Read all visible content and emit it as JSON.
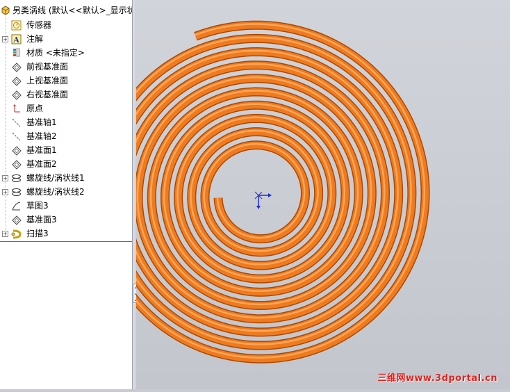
{
  "tree": {
    "root_label": "另类涡线 (默认<<默认>_显示状",
    "items": [
      {
        "label": "传感器",
        "icon": "sensor-icon",
        "expander": false
      },
      {
        "label": "注解",
        "icon": "annotation-icon",
        "expander": true
      },
      {
        "label": "材质 <未指定>",
        "icon": "material-icon",
        "expander": false
      },
      {
        "label": "前视基准面",
        "icon": "plane-icon",
        "expander": false
      },
      {
        "label": "上视基准面",
        "icon": "plane-icon",
        "expander": false
      },
      {
        "label": "右视基准面",
        "icon": "plane-icon",
        "expander": false
      },
      {
        "label": "原点",
        "icon": "origin-icon",
        "expander": false
      },
      {
        "label": "基准轴1",
        "icon": "axis-icon",
        "expander": false
      },
      {
        "label": "基准轴2",
        "icon": "axis-icon",
        "expander": false
      },
      {
        "label": "基准面1",
        "icon": "plane-icon",
        "expander": false
      },
      {
        "label": "基准面2",
        "icon": "plane-icon",
        "expander": false
      },
      {
        "label": "螺旋线/涡状线1",
        "icon": "helix-icon",
        "expander": true
      },
      {
        "label": "螺旋线/涡状线2",
        "icon": "helix-icon",
        "expander": true
      },
      {
        "label": "草图3",
        "icon": "sketch-icon",
        "expander": false
      },
      {
        "label": "基准面3",
        "icon": "plane-icon",
        "expander": false
      },
      {
        "label": "扫描3",
        "icon": "sweep-icon",
        "expander": true
      }
    ]
  },
  "viewport": {
    "model_color": "#f07a1c",
    "model_shadow_color": "#a84a08",
    "model_highlight_color": "#ffb36b",
    "triad_color": "#1a2fd6"
  },
  "watermark": "三维网www.3dportal.cn"
}
